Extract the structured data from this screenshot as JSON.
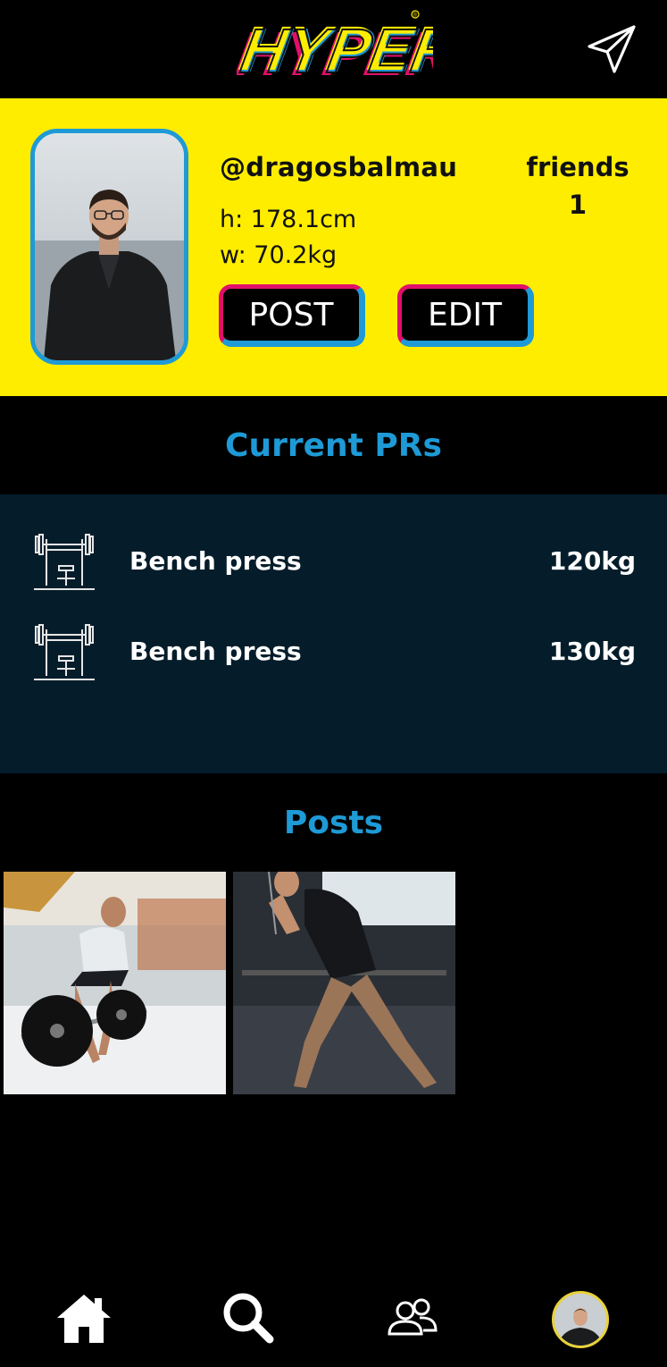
{
  "app": {
    "logo_text": "HYPER",
    "logo_trademark": "®",
    "send_icon": "paper-plane-icon"
  },
  "profile": {
    "username": "@dragosbalmau",
    "height": "h: 178.1cm",
    "weight": "w: 70.2kg",
    "friends_label": "friends",
    "friends_count": "1",
    "post_label": "POST",
    "edit_label": "EDIT"
  },
  "prs": {
    "title": "Current PRs",
    "items": [
      {
        "exercise": "Bench press",
        "value": "120kg",
        "icon": "bench-press-icon"
      },
      {
        "exercise": "Bench press",
        "value": "130kg",
        "icon": "bench-press-icon"
      }
    ]
  },
  "posts": {
    "title": "Posts",
    "items": [
      {
        "image": "deadlift-photo"
      },
      {
        "image": "cable-exercise-photo"
      }
    ]
  },
  "nav": {
    "items": [
      "home-icon",
      "search-icon",
      "friends-icon",
      "profile-avatar"
    ]
  },
  "colors": {
    "accent_blue": "#1e9ad6",
    "accent_pink": "#e0106a",
    "profile_yellow": "#ffed00",
    "panel_navy": "#051d2b"
  }
}
